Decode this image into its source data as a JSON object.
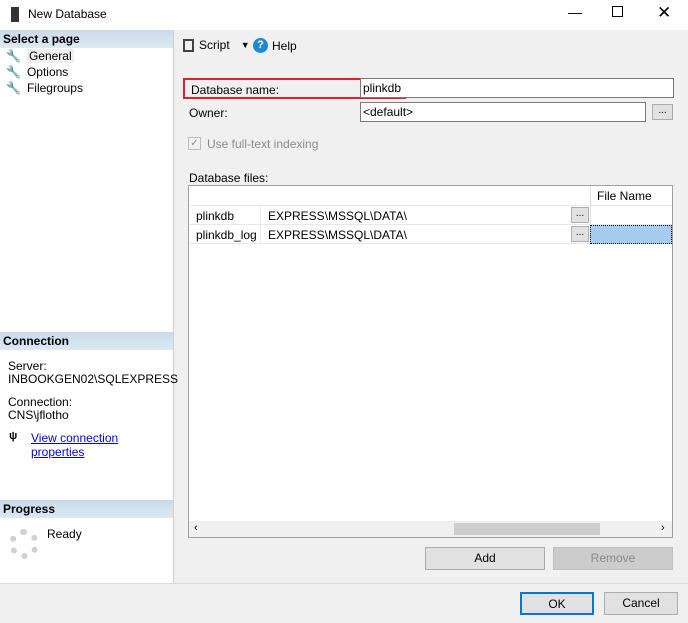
{
  "window": {
    "title": "New Database"
  },
  "sidebar": {
    "select_page": "Select a page",
    "pages": [
      {
        "label": "General"
      },
      {
        "label": "Options"
      },
      {
        "label": "Filegroups"
      }
    ],
    "connection_header": "Connection",
    "server_label": "Server:",
    "server_value": "INBOOKGEN02\\SQLEXPRESS",
    "connection_label": "Connection:",
    "connection_value": "CNS\\jflotho",
    "view_props": "View connection properties",
    "progress_header": "Progress",
    "progress_status": "Ready"
  },
  "toolbar": {
    "script": "Script",
    "help": "Help"
  },
  "form": {
    "db_name_label": "Database name:",
    "db_name_value": "plinkdb",
    "owner_label": "Owner:",
    "owner_value": "<default>",
    "fulltext_label": "Use full-text indexing",
    "files_label": "Database files:"
  },
  "files": {
    "col_file_name": "File Name",
    "rows": [
      {
        "name": "plinkdb",
        "path": "EXPRESS\\MSSQL\\DATA\\"
      },
      {
        "name": "plinkdb_log",
        "path": "EXPRESS\\MSSQL\\DATA\\"
      }
    ]
  },
  "buttons": {
    "add": "Add",
    "remove": "Remove",
    "ok": "OK",
    "cancel": "Cancel",
    "browse": "..."
  }
}
